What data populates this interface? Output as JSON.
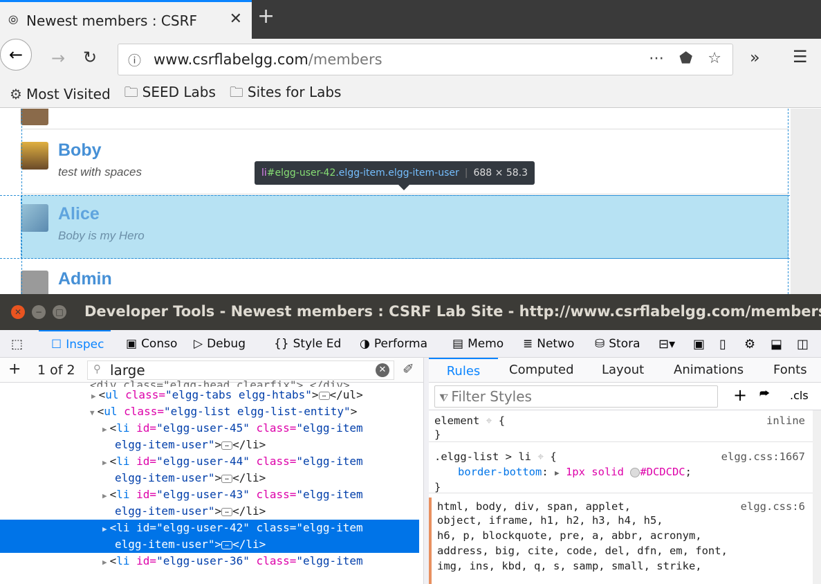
{
  "browser": {
    "tab_title": "Newest members : CSRF",
    "url_host": "www.csrflabelgg.com",
    "url_path": "/members",
    "bookmarks": [
      "Most Visited",
      "SEED Labs",
      "Sites for Labs"
    ]
  },
  "page": {
    "members": [
      {
        "name": "Boby",
        "desc": "test with spaces"
      },
      {
        "name": "Alice",
        "desc": "Boby is my Hero"
      },
      {
        "name": "Admin",
        "desc": ""
      }
    ],
    "tooltip": {
      "tag": "li",
      "id": "#elgg-user-42",
      "classes": ".elgg-item.elgg-item-user",
      "dims": "688 × 58.3"
    }
  },
  "devtools": {
    "title": "Developer Tools - Newest members : CSRF Lab Site - http://www.csrflabelgg.com/members",
    "tabs": [
      "Inspec",
      "Conso",
      "Debug",
      "Style Ed",
      "Performa",
      "Memo",
      "Netwo",
      "Stora"
    ],
    "search": {
      "count": "1 of 2",
      "value": "large"
    },
    "markup_lines": [
      {
        "indent": 0,
        "text": "<div class=\"elgg-head clearfix\">…</div>"
      },
      {
        "indent": 1,
        "pre": "<",
        "tag": "ul",
        "attr": " class=",
        "val": "\"elgg-tabs elgg-htabs\"",
        "post": ">",
        "tail": "</ul>"
      },
      {
        "indent": 1,
        "pre": "<",
        "tag": "ul",
        "attr": " class=",
        "val": "\"elgg-list elgg-list-entity\"",
        "post": ">",
        "tail": ""
      },
      {
        "indent": 2,
        "pre": "<",
        "tag": "li",
        "attr": " id=",
        "val": "\"elgg-user-45\"",
        "attr2": " class=",
        "val2": "\"elgg-item",
        "cont": "elgg-item-user\"",
        "tail": "</li>"
      },
      {
        "indent": 2,
        "pre": "<",
        "tag": "li",
        "attr": " id=",
        "val": "\"elgg-user-44\"",
        "attr2": " class=",
        "val2": "\"elgg-item",
        "cont": "elgg-item-user\"",
        "tail": "</li>"
      },
      {
        "indent": 2,
        "pre": "<",
        "tag": "li",
        "attr": " id=",
        "val": "\"elgg-user-43\"",
        "attr2": " class=",
        "val2": "\"elgg-item",
        "cont": "elgg-item-user\"",
        "tail": "</li>"
      },
      {
        "indent": 2,
        "pre": "<",
        "tag": "li",
        "attr": " id=",
        "val": "\"elgg-user-42\"",
        "attr2": " class=",
        "val2": "\"elgg-item",
        "cont": "elgg-item-user\"",
        "tail": "</li>"
      },
      {
        "indent": 2,
        "pre": "<",
        "tag": "li",
        "attr": " id=",
        "val": "\"elgg-user-36\"",
        "attr2": " class=",
        "val2": "\"elgg-item",
        "cont": "",
        "tail": ""
      }
    ],
    "rule_tabs": [
      "Rules",
      "Computed",
      "Layout",
      "Animations",
      "Fonts"
    ],
    "filter_placeholder": "Filter Styles",
    "cls_label": ".cls",
    "rules": [
      {
        "selector": "element",
        "source": "inline",
        "decls": []
      },
      {
        "selector": ".elgg-list > li",
        "source": "elgg.css:1667",
        "decls": [
          {
            "prop": "border-bottom",
            "val": "1px solid",
            "color": "#DCDCDC"
          }
        ]
      },
      {
        "selector": "html, body, div, span, applet,",
        "source": "elgg.css:6",
        "more": [
          "object, iframe, h1, h2, h3, h4, h5,",
          "h6, p, blockquote, pre, a, abbr, acronym,",
          "address, big, cite, code, del, dfn, em, font,",
          "img, ins, kbd, q, s, samp, small, strike,"
        ]
      }
    ]
  }
}
